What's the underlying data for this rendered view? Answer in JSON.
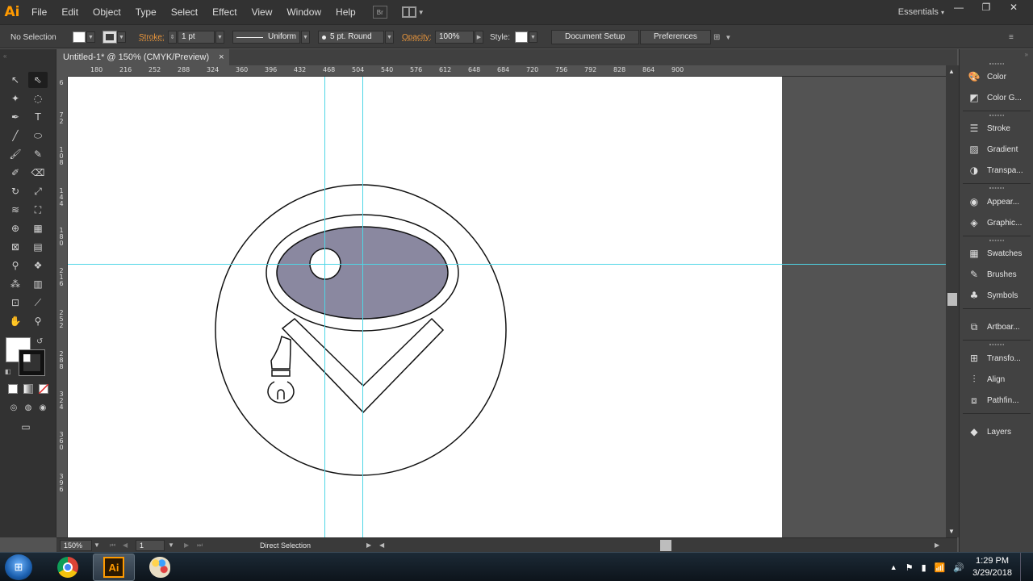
{
  "app": {
    "logo": "Ai",
    "workspace": "Essentials"
  },
  "menu": [
    "File",
    "Edit",
    "Object",
    "Type",
    "Select",
    "Effect",
    "View",
    "Window",
    "Help"
  ],
  "menu_extra": {
    "bridge": "Br"
  },
  "controlbar": {
    "selection": "No Selection",
    "stroke_label": "Stroke:",
    "stroke_weight": "1 pt",
    "profile": "Uniform",
    "brush": "5 pt. Round",
    "opacity_label": "Opacity:",
    "opacity": "100%",
    "style_label": "Style:",
    "document_setup": "Document Setup",
    "preferences": "Preferences"
  },
  "document": {
    "tab_title": "Untitled-1* @ 150% (CMYK/Preview)",
    "close": "×"
  },
  "ruler_top": [
    "180",
    "216",
    "252",
    "288",
    "324",
    "360",
    "396",
    "432",
    "468",
    "504",
    "540",
    "576",
    "612",
    "648",
    "684",
    "720",
    "756",
    "792",
    "828",
    "864",
    "900"
  ],
  "ruler_left": [
    "6",
    "7\n2",
    "1\n0\n8",
    "1\n4\n4",
    "1\n8\n0",
    "2\n1\n6",
    "2\n5\n2",
    "2\n8\n8",
    "3\n2\n4",
    "3\n6\n0",
    "3\n9\n6"
  ],
  "statusbar": {
    "zoom": "150%",
    "page": "1",
    "tool": "Direct Selection"
  },
  "panels": [
    {
      "label": "Color",
      "icon": "color-palette-icon"
    },
    {
      "label": "Color G...",
      "icon": "color-guide-icon"
    },
    {
      "label": "Stroke",
      "icon": "stroke-lines-icon"
    },
    {
      "label": "Gradient",
      "icon": "gradient-icon"
    },
    {
      "label": "Transpa...",
      "icon": "transparency-icon"
    },
    {
      "label": "Appear...",
      "icon": "appearance-icon"
    },
    {
      "label": "Graphic...",
      "icon": "graphic-styles-icon"
    },
    {
      "label": "Swatches",
      "icon": "swatches-grid-icon"
    },
    {
      "label": "Brushes",
      "icon": "brush-icon"
    },
    {
      "label": "Symbols",
      "icon": "club-icon"
    },
    {
      "label": "Artboar...",
      "icon": "artboards-icon"
    },
    {
      "label": "Transfo...",
      "icon": "transform-icon"
    },
    {
      "label": "Align",
      "icon": "align-icon"
    },
    {
      "label": "Pathfin...",
      "icon": "pathfinder-icon"
    },
    {
      "label": "Layers",
      "icon": "layers-icon"
    }
  ],
  "taskbar": {
    "time": "1:29 PM",
    "date": "3/29/2018"
  },
  "colors": {
    "accent": "#ff9a00",
    "guide": "#4fd6e6",
    "ellipse_fill": "#8a88a0"
  }
}
